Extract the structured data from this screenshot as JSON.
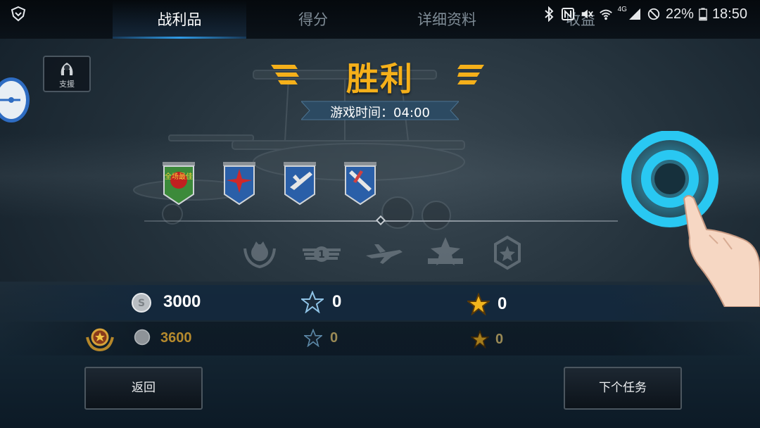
{
  "tabs": [
    {
      "label": "战利品",
      "active": true
    },
    {
      "label": "得分",
      "active": false
    },
    {
      "label": "详细资料",
      "active": false
    },
    {
      "label": "收益",
      "active": false
    }
  ],
  "status_bar": {
    "network": "4G",
    "battery": "22%",
    "time": "18:50"
  },
  "support": {
    "label": "支援"
  },
  "result": {
    "title": "胜利",
    "game_time_text": "游戏时间：04:00"
  },
  "medals": [
    {
      "icon": "best-player-medal-icon",
      "text": "全场最佳"
    },
    {
      "icon": "red-star-medal-icon"
    },
    {
      "icon": "plane-medal-icon"
    },
    {
      "icon": "plane-dive-medal-icon"
    }
  ],
  "achievements": [
    "laurel-crown-icon",
    "rank-one-wings-icon",
    "airplane-icon",
    "star-ribbon-icon",
    "hexagon-badge-icon"
  ],
  "rewards": {
    "row1": {
      "silver": "3000",
      "blue_star": "0",
      "gold_star": "0"
    },
    "row2": {
      "silver": "3600",
      "blue_star": "0",
      "gold_star": "0"
    }
  },
  "buttons": {
    "back": "返回",
    "next": "下个任务"
  },
  "colors": {
    "accent_gold": "#f5b01a",
    "tab_underline": "#2f9be6",
    "tutorial_ring": "#29c8f2"
  }
}
